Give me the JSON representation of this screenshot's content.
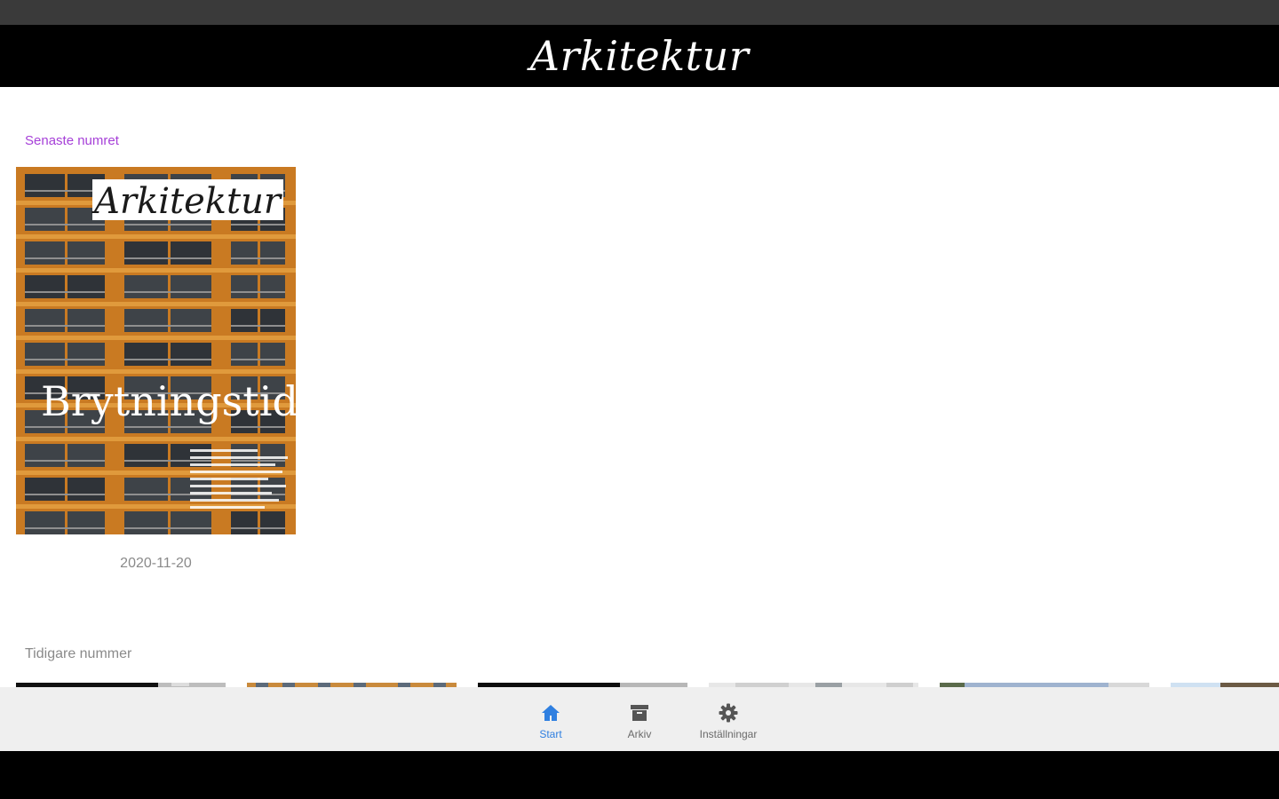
{
  "app": {
    "title": "Arkitektur"
  },
  "latest": {
    "heading": "Senaste numret",
    "cover_masthead": "Arkitektur",
    "cover_headline": "Brytningstid",
    "date": "2020-11-20"
  },
  "previous": {
    "heading": "Tidigare nummer"
  },
  "nav": {
    "items": [
      {
        "label": "Start",
        "icon": "home-icon",
        "active": true
      },
      {
        "label": "Arkiv",
        "icon": "archive-icon",
        "active": false
      },
      {
        "label": "Inställningar",
        "icon": "gear-icon",
        "active": false
      }
    ]
  },
  "colors": {
    "accent": "#2f7fe0",
    "section_heading": "#a640d8",
    "appbar": "#000000",
    "nav_background": "#efefef"
  }
}
